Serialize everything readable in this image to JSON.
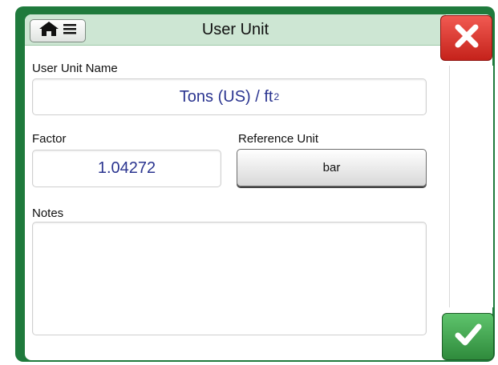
{
  "window": {
    "title": "User Unit"
  },
  "header": {
    "home_icon": "home-icon",
    "menu_icon": "hamburger-icon"
  },
  "user_unit_name": {
    "label": "User Unit Name",
    "value": "Tons (US) / ft",
    "superscript": "2"
  },
  "factor": {
    "label": "Factor",
    "value": "1.04272"
  },
  "reference_unit": {
    "label": "Reference Unit",
    "value": "bar"
  },
  "notes": {
    "label": "Notes",
    "value": ""
  },
  "buttons": {
    "close_icon": "close-icon",
    "accept_icon": "checkmark-icon"
  },
  "colors": {
    "frame": "#1f7a3c",
    "titlebar": "#cde6d3",
    "value_text": "#2b3590",
    "close": "#d9322b",
    "accept": "#3fa64e"
  }
}
